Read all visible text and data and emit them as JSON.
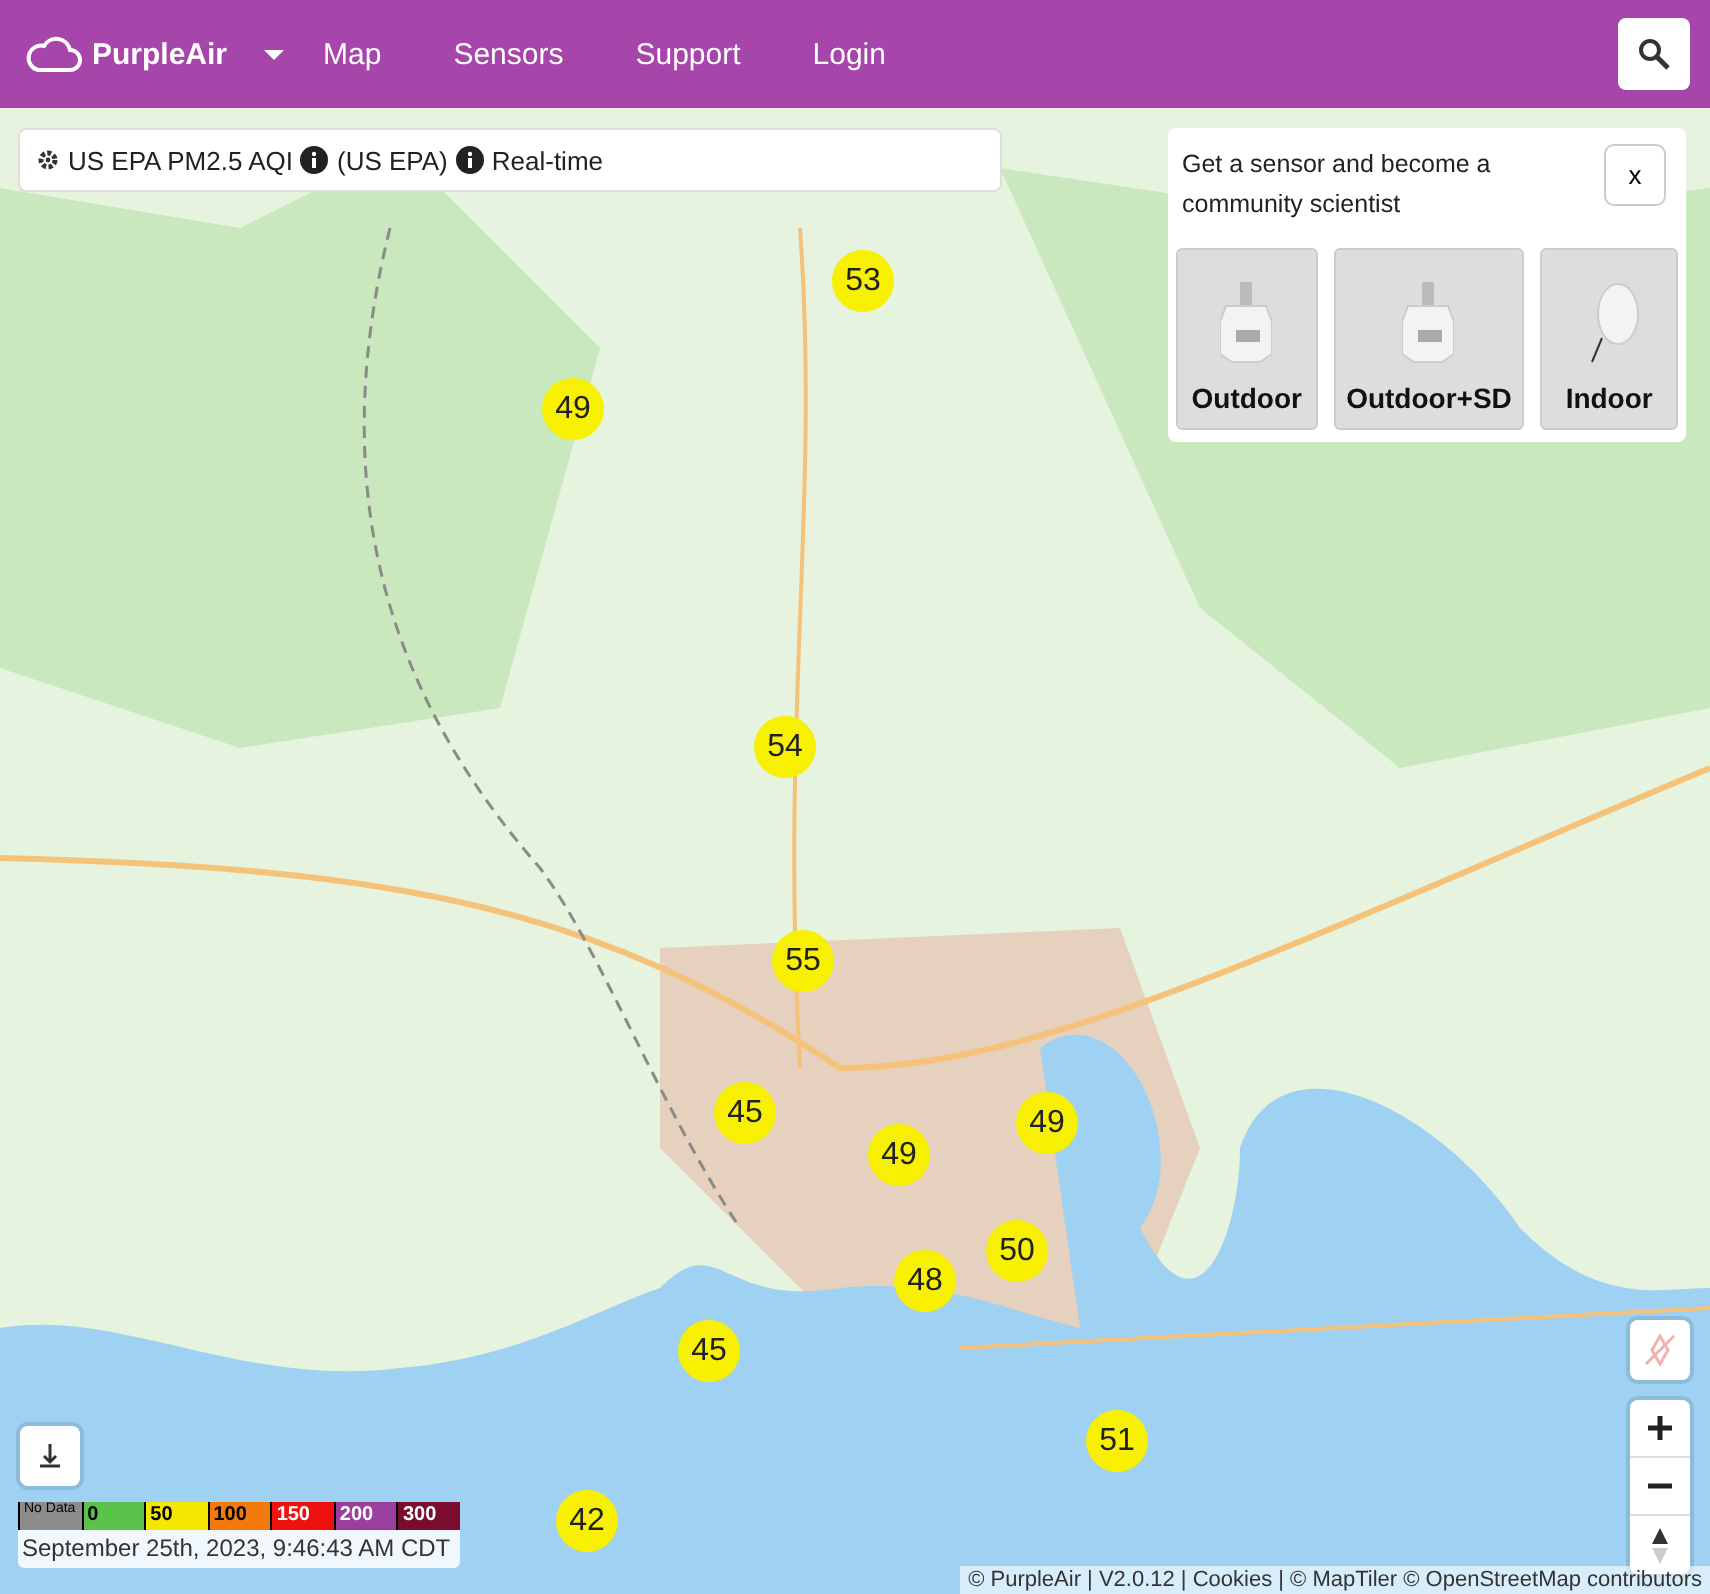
{
  "navbar": {
    "brand": "PurpleAir",
    "links": [
      {
        "label": "Map"
      },
      {
        "label": "Sensors"
      },
      {
        "label": "Support"
      },
      {
        "label": "Login"
      }
    ]
  },
  "layer_bar": {
    "metric": "US EPA PM2.5 AQI",
    "conversion": "(US EPA)",
    "period": "Real-time"
  },
  "sensor_promo": {
    "title": "Get a sensor and become a community scientist",
    "close": "x",
    "products": [
      {
        "label": "Outdoor",
        "kind": "outdoor"
      },
      {
        "label": "Outdoor+SD",
        "kind": "outdoor"
      },
      {
        "label": "Indoor",
        "kind": "indoor"
      }
    ]
  },
  "markers": [
    {
      "value": "53"
    },
    {
      "value": "49"
    },
    {
      "value": "54"
    },
    {
      "value": "55"
    },
    {
      "value": "45"
    },
    {
      "value": "49"
    },
    {
      "value": "49"
    },
    {
      "value": "50"
    },
    {
      "value": "48"
    },
    {
      "value": "45"
    },
    {
      "value": "51"
    },
    {
      "value": "42"
    }
  ],
  "legend": {
    "segments": [
      {
        "label": "No Data",
        "color": "#8c8c8c"
      },
      {
        "label": "0",
        "color": "#5bc24a"
      },
      {
        "label": "50",
        "color": "#f5e800"
      },
      {
        "label": "100",
        "color": "#f27a0c"
      },
      {
        "label": "150",
        "color": "#ef1010"
      },
      {
        "label": "200",
        "color": "#9a3f9e"
      },
      {
        "label": "300",
        "color": "#7a0d2e"
      }
    ],
    "timestamp": "September 25th, 2023, 9:46:43 AM CDT"
  },
  "attribution": "© PurpleAir | V2.0.12 | Cookies | © MapTiler © OpenStreetMap contributors"
}
